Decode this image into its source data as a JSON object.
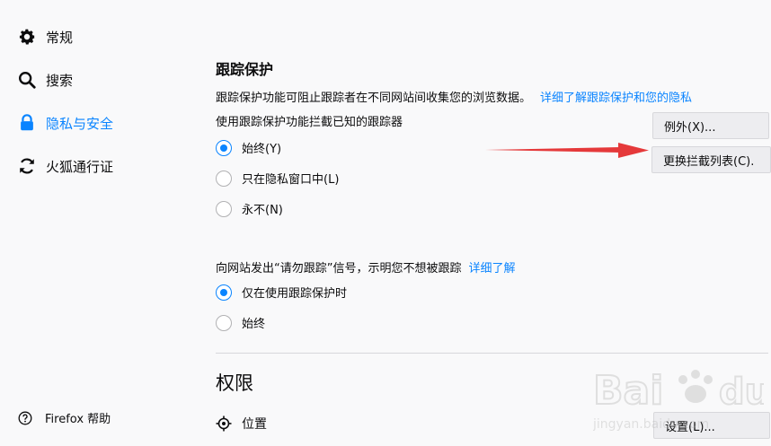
{
  "sidebar": {
    "items": [
      {
        "label": "常规",
        "icon": "gear-icon"
      },
      {
        "label": "搜索",
        "icon": "search-icon"
      },
      {
        "label": "隐私与安全",
        "icon": "lock-icon",
        "active": true
      },
      {
        "label": "火狐通行证",
        "icon": "sync-icon"
      }
    ],
    "help_label": "Firefox 帮助"
  },
  "tracking": {
    "title": "跟踪保护",
    "description": "跟踪保护功能可阻止跟踪者在不同网站间收集您的浏览数据。",
    "learn_more": "详细了解跟踪保护和您的隐私",
    "subheading": "使用跟踪保护功能拦截已知的跟踪器",
    "options": [
      "始终(Y)",
      "只在隐私窗口中(L)",
      "永不(N)"
    ],
    "selected": "始终(Y)",
    "exceptions_button": "例外(X)...",
    "change_list_button": "更换拦截列表(C)."
  },
  "dnt": {
    "text": "向网站发出“请勿跟踪”信号，示明您不想被跟踪",
    "learn_more": "详细了解",
    "options": [
      "仅在使用跟踪保护时",
      "始终"
    ],
    "selected": "仅在使用跟踪保护时"
  },
  "permissions": {
    "title": "权限",
    "location_label": "位置",
    "settings_button": "设置(L)..."
  },
  "colors": {
    "accent": "#0a84ff",
    "arrow": "#e5393a"
  }
}
